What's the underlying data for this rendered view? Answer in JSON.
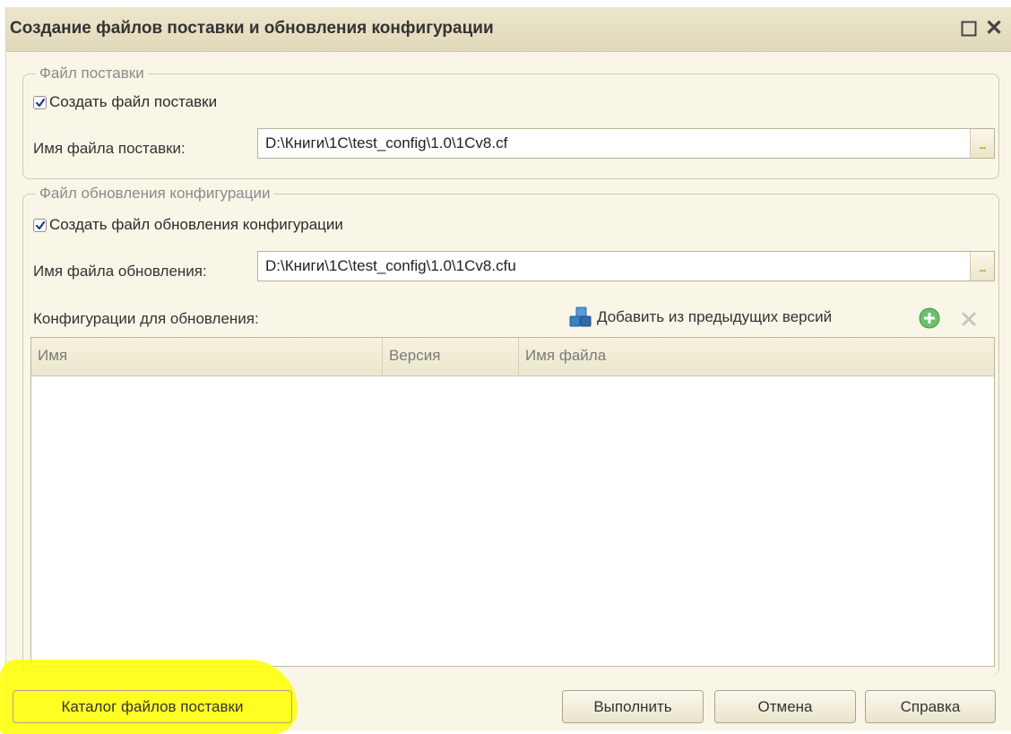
{
  "window": {
    "title": "Создание файлов поставки и обновления конфигурации",
    "restore_glyph": "□",
    "close_glyph": "✕"
  },
  "delivery": {
    "legend": "Файл поставки",
    "checkbox_label": "Создать файл поставки",
    "checked": true,
    "file_label": "Имя файла поставки:",
    "file_value": "D:\\Книги\\1С\\test_config\\1.0\\1Cv8.cf",
    "browse": "..."
  },
  "update": {
    "legend": "Файл обновления конфигурации",
    "checkbox_label": "Создать файл обновления конфигурации",
    "checked": true,
    "file_label": "Имя файла обновления:",
    "file_value": "D:\\Книги\\1С\\test_config\\1.0\\1Cv8.cfu",
    "browse": "...",
    "configs_label": "Конфигурации для обновления:",
    "add_from_prev": "Добавить из предыдущих версий"
  },
  "table": {
    "columns": [
      "Имя",
      "Версия",
      "Имя файла"
    ],
    "rows": []
  },
  "buttons": {
    "catalog": "Каталог файлов поставки",
    "execute": "Выполнить",
    "cancel": "Отмена",
    "help": "Справка"
  },
  "colors": {
    "window_bg": "#f9f6e8",
    "highlight": "#ffff00",
    "add_icon": "#5cb85c",
    "cube_icon": "#3a7fc4"
  },
  "icons": {
    "add_prev": "cubes-icon",
    "add": "plus-circle-icon",
    "delete": "cross-icon"
  }
}
